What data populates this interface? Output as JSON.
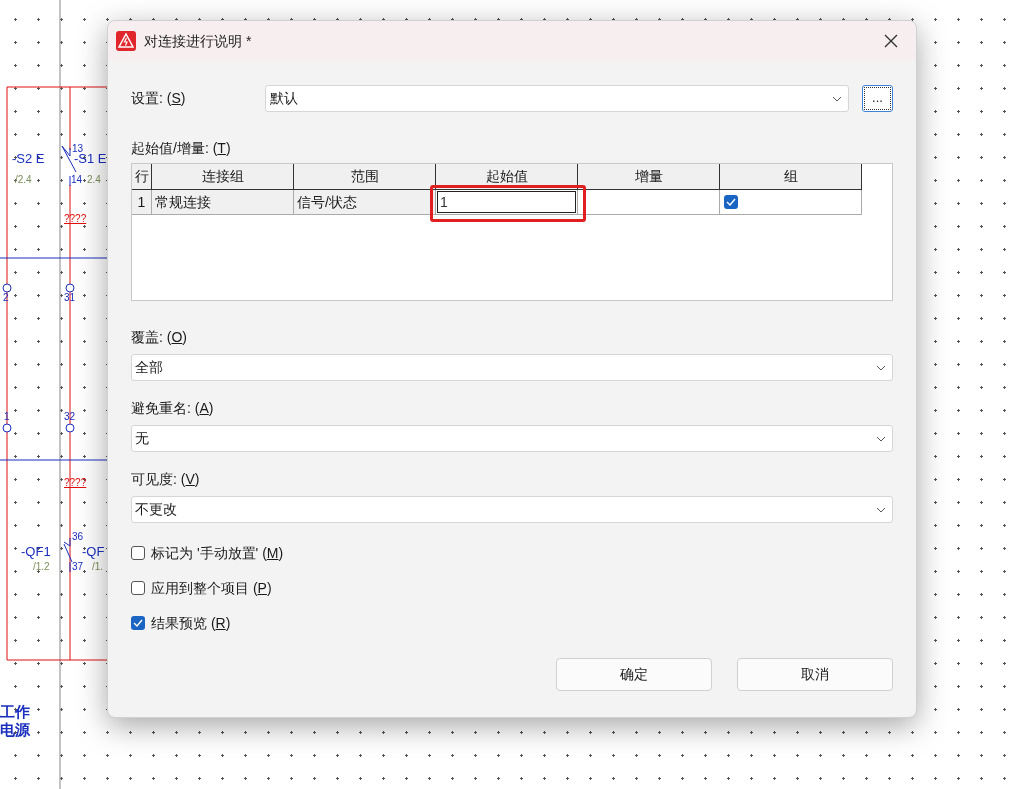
{
  "schematic": {
    "labels": [
      {
        "text": "-S2 E",
        "kind": "device"
      },
      {
        "text": "-S1 E",
        "kind": "device"
      },
      {
        "text": "/2.4",
        "kind": "ref"
      },
      {
        "text": "13",
        "kind": "pin"
      },
      {
        "text": "14",
        "kind": "pin"
      },
      {
        "text": "2.4",
        "kind": "ref"
      },
      {
        "text": "????",
        "kind": "note"
      },
      {
        "text": "2",
        "kind": "pin"
      },
      {
        "text": "31",
        "kind": "pin"
      },
      {
        "text": "1",
        "kind": "pin"
      },
      {
        "text": "32",
        "kind": "pin"
      },
      {
        "text": "????",
        "kind": "note"
      },
      {
        "text": "36",
        "kind": "pin"
      },
      {
        "text": "-QF1",
        "kind": "device"
      },
      {
        "text": "-QF",
        "kind": "device"
      },
      {
        "text": "/1.2",
        "kind": "ref"
      },
      {
        "text": "37",
        "kind": "pin"
      },
      {
        "text": "/1.",
        "kind": "ref"
      },
      {
        "text": "工作",
        "kind": "title"
      },
      {
        "text": "电源",
        "kind": "title"
      }
    ]
  },
  "dialog": {
    "title": "对连接进行说明 *",
    "settings": {
      "label": "设置: (S)",
      "value": "默认",
      "browse_button": "..."
    },
    "table": {
      "label": "起始值/增量: (T)",
      "columns": [
        "行",
        "连接组",
        "范围",
        "起始值",
        "增量",
        "组"
      ],
      "rows": [
        {
          "row_number": "1",
          "connection_group": "常规连接",
          "scope": "信号/状态",
          "start_value": "1",
          "start_value_highlighted": true,
          "group": true
        }
      ]
    },
    "dropdowns": [
      {
        "label": "覆盖: (O)",
        "value": "全部"
      },
      {
        "label": "避免重名: (A)",
        "value": "无"
      },
      {
        "label": "可见度: (V)",
        "value": "不更改"
      }
    ],
    "checkboxes": [
      {
        "label": "标记为 '手动放置' (M)",
        "checked": false
      },
      {
        "label": "应用到整个项目 (P)",
        "checked": false
      },
      {
        "label": "结果预览 (R)",
        "checked": true
      }
    ],
    "buttons": [
      "确定",
      "取消"
    ]
  }
}
